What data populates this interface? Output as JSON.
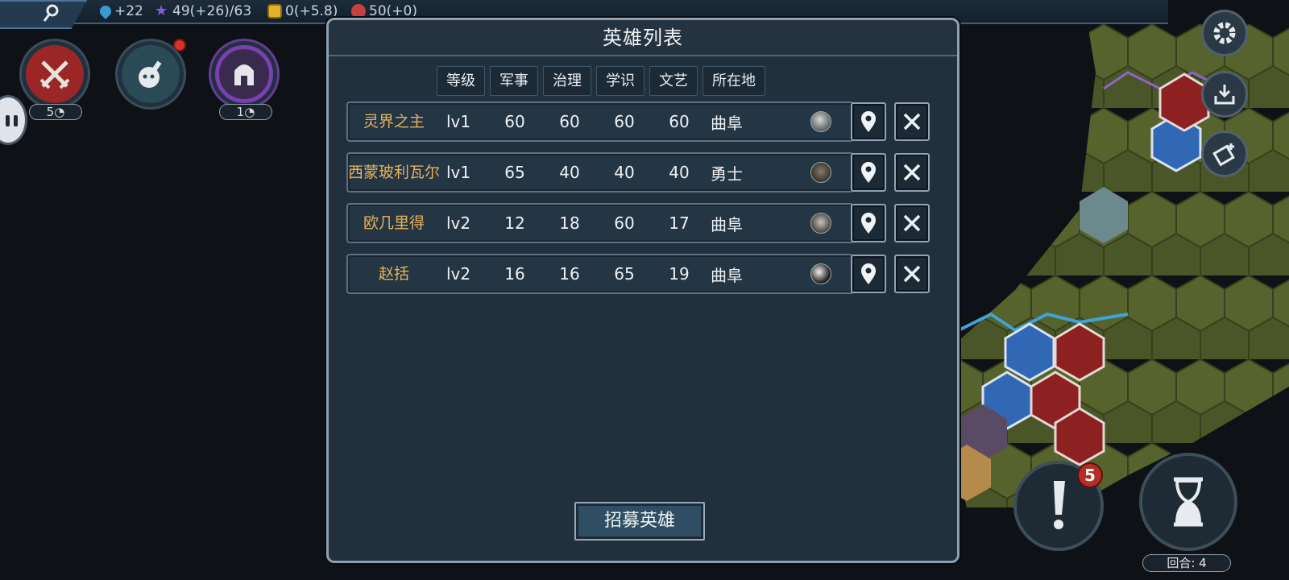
{
  "topbar": {
    "resources": [
      {
        "icon": "water-drop-icon",
        "value": "+22"
      },
      {
        "icon": "star-icon",
        "value": "49(+26)/63"
      },
      {
        "icon": "coin-icon",
        "value": "0(+5.8)"
      },
      {
        "icon": "food-icon",
        "value": "50(+0)"
      }
    ]
  },
  "left_buttons": {
    "military_count": "5",
    "advisor_count": "1"
  },
  "dialog": {
    "title": "英雄列表",
    "columns": [
      "等级",
      "军事",
      "治理",
      "学识",
      "文艺",
      "所在地"
    ],
    "heroes": [
      {
        "name": "灵界之主",
        "level": "lv1",
        "military": "60",
        "governance": "60",
        "knowledge": "60",
        "arts": "60",
        "location": "曲阜"
      },
      {
        "name": "西蒙玻利瓦尔",
        "level": "lv1",
        "military": "65",
        "governance": "40",
        "knowledge": "40",
        "arts": "40",
        "location": "勇士"
      },
      {
        "name": "欧几里得",
        "level": "lv2",
        "military": "12",
        "governance": "18",
        "knowledge": "60",
        "arts": "17",
        "location": "曲阜"
      },
      {
        "name": "赵括",
        "level": "lv2",
        "military": "16",
        "governance": "16",
        "knowledge": "65",
        "arts": "19",
        "location": "曲阜"
      }
    ],
    "recruit_label": "招募英雄"
  },
  "hud": {
    "alert_count": "5",
    "turn_label": "回合: 4"
  },
  "colors": {
    "accent_gold": "#e8b25b",
    "panel_bg": "#22303d",
    "alert_red": "#b42d26"
  }
}
